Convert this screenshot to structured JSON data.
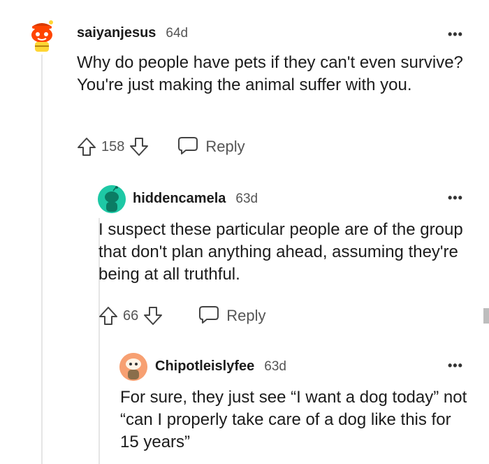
{
  "comments": [
    {
      "username": "saiyanjesus",
      "age": "64d",
      "more": "•••",
      "text": "Why do people have pets if they can't even survive? You're just making the animal suffer with you.",
      "score": "158",
      "reply_label": "Reply"
    },
    {
      "username": "hiddencamela",
      "age": "63d",
      "more": "•••",
      "text": "I suspect these particular people are of the group that don't plan anything ahead, assuming they're being at all truthful.",
      "score": "66",
      "reply_label": "Reply"
    },
    {
      "username": "Chipotleislyfee",
      "age": "63d",
      "more": "•••",
      "text": "For sure, they just see “I want a dog today” not “can I properly take care of a dog like this for 15 years”"
    }
  ],
  "icons": {
    "upvote": "upvote-arrow-icon",
    "downvote": "downvote-arrow-icon",
    "reply": "speech-bubble-icon",
    "avatar_1": "snoo-avatar-red-hat",
    "avatar_2": "snoo-avatar-teal",
    "avatar_3": "snoo-avatar-orange"
  },
  "colors": {
    "text": "#1c1c1c",
    "meta": "#555555",
    "thread_line": "#e5e5e5",
    "avatar_teal": "#1ec8a5",
    "avatar_orange": "#f7a072"
  }
}
